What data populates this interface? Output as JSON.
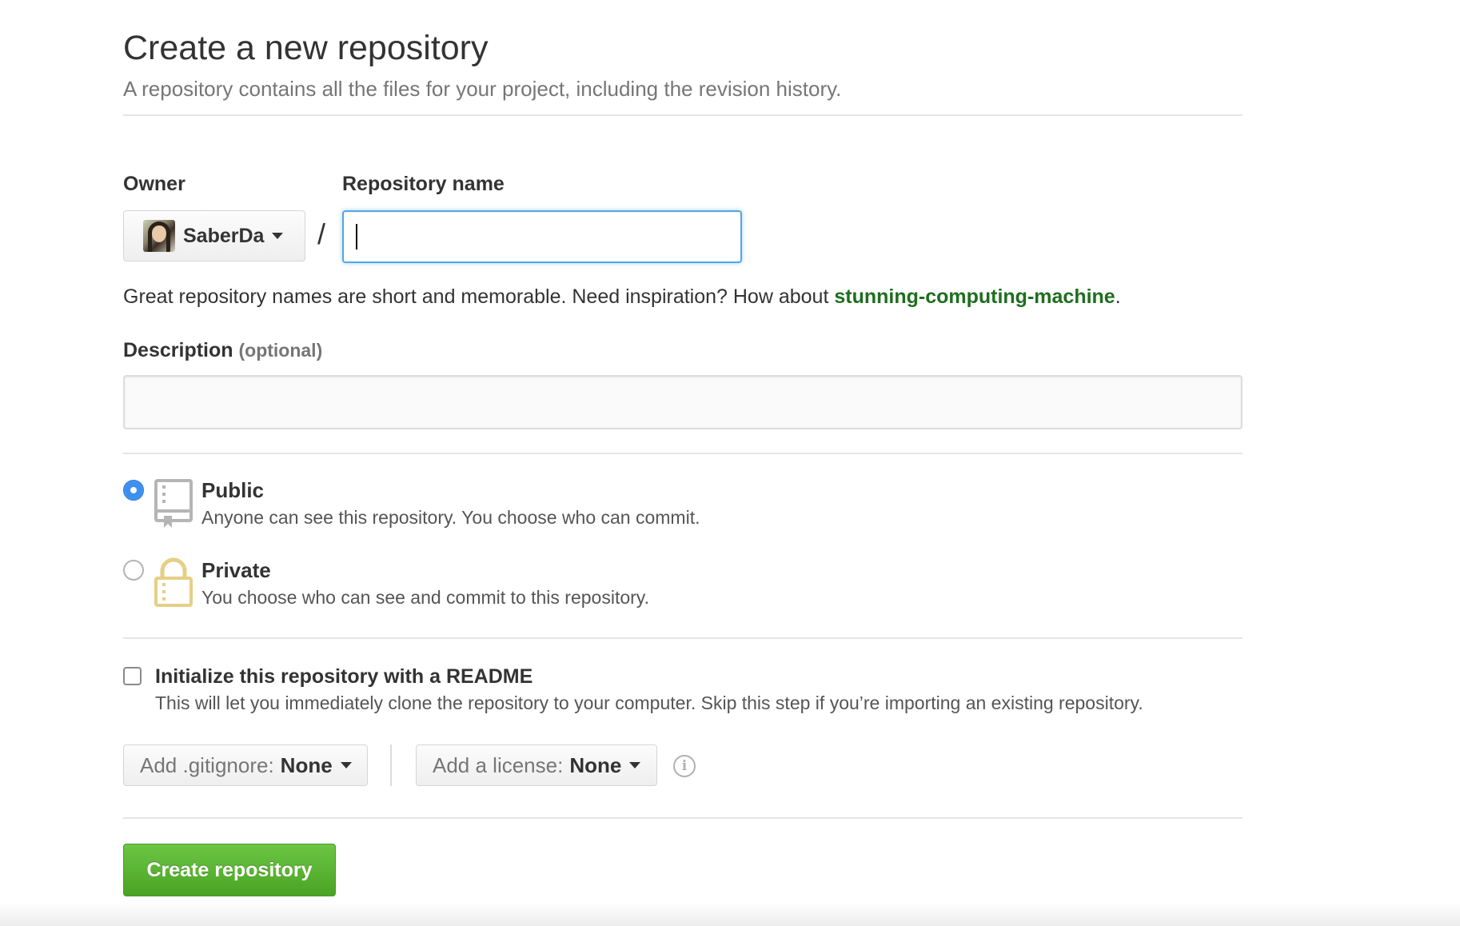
{
  "header": {
    "title": "Create a new repository",
    "subtitle": "A repository contains all the files for your project, including the revision history."
  },
  "owner": {
    "label": "Owner",
    "name": "SaberDa",
    "avatar_icon": "user-avatar"
  },
  "repository_name": {
    "label": "Repository name",
    "separator": "/",
    "value": ""
  },
  "hint": {
    "prefix": "Great repository names are short and memorable. Need inspiration? How about ",
    "suggestion": "stunning-computing-machine",
    "suffix": "."
  },
  "description": {
    "label": "Description",
    "optional": "(optional)",
    "value": ""
  },
  "visibility": {
    "selected": "public",
    "public": {
      "title": "Public",
      "desc": "Anyone can see this repository. You choose who can commit.",
      "icon": "repo-book-icon"
    },
    "private": {
      "title": "Private",
      "desc": "You choose who can see and commit to this repository.",
      "icon": "lock-icon"
    }
  },
  "readme": {
    "checked": false,
    "title": "Initialize this repository with a README",
    "desc": "This will let you immediately clone the repository to your computer. Skip this step if you’re importing an existing repository."
  },
  "gitignore": {
    "label": "Add .gitignore:",
    "value": "None"
  },
  "license": {
    "label": "Add a license:",
    "value": "None",
    "info_icon": "info-icon"
  },
  "submit": {
    "label": "Create repository"
  },
  "colors": {
    "accent_blue": "#51a7e8",
    "radio_blue": "#3d8ff0",
    "suggestion_green": "#1e6e1e",
    "button_green": "#55a532",
    "lock_gold": "#e6cf85"
  }
}
